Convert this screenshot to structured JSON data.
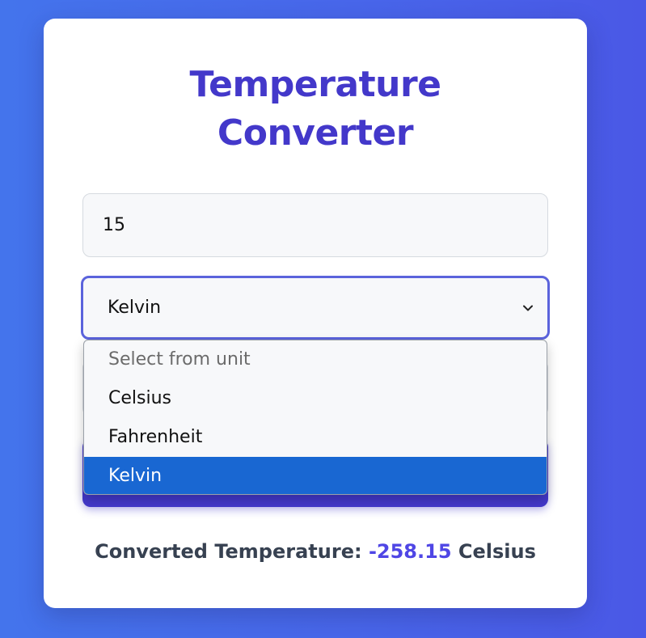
{
  "title": {
    "line1": "Temperature",
    "line2": "Converter"
  },
  "value_input": {
    "value": "15"
  },
  "from_unit": {
    "selected": "Kelvin",
    "icon": "chevron-down-icon",
    "focus_color": "#5b63dc",
    "options": [
      {
        "label": "Select from unit",
        "placeholder": true
      },
      {
        "label": "Celsius"
      },
      {
        "label": "Fahrenheit"
      },
      {
        "label": "Kelvin",
        "highlighted": true
      }
    ]
  },
  "result": {
    "label": "Converted Temperature:",
    "value": "-258.15",
    "unit": "Celsius"
  },
  "colors": {
    "accent": "#4338ca",
    "highlight": "#1967d2",
    "background_start": "#4474ec",
    "background_end": "#4a58e6"
  }
}
